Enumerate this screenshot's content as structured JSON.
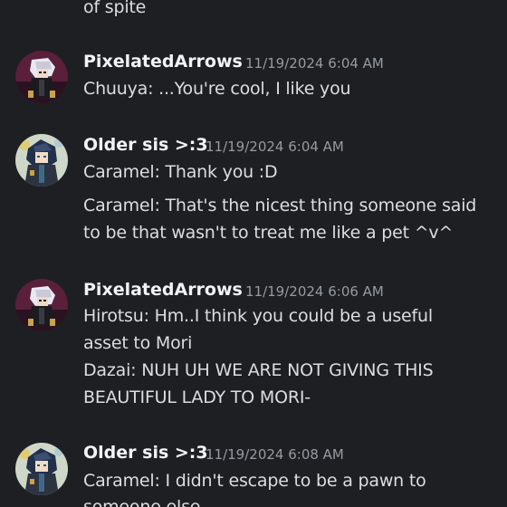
{
  "messages": [
    {
      "lines": [
        "of spite"
      ]
    },
    {
      "author": "PixelatedArrows",
      "timestamp": "11/19/2024 6:04 AM",
      "lines": [
        "Chuuya: ...You're cool, I like you"
      ]
    },
    {
      "author": "Older sis >:3",
      "timestamp": "11/19/2024 6:04 AM",
      "lines": [
        "Caramel: Thank you :D",
        "Caramel: That's the nicest thing someone said",
        "to be that wasn't to treat me like a pet ^v^"
      ]
    },
    {
      "author": "PixelatedArrows",
      "timestamp": "11/19/2024 6:06 AM",
      "lines": [
        "Hirotsu: Hm..I think you could be a useful",
        "asset to Mori",
        "Dazai: NUH UH WE ARE NOT GIVING THIS",
        "BEAUTIFUL LADY TO MORI-"
      ]
    },
    {
      "author": "Older sis >:3",
      "timestamp": "11/19/2024 6:08 AM",
      "lines": [
        "Caramel: I didn't escape to be a pawn to",
        "someone else"
      ]
    }
  ],
  "colors": {
    "background": "#1e1f22",
    "text": "#dbdee1",
    "author": "#f2f3f5",
    "timestamp": "#949ba4",
    "avatar_pixelated_bg": "#5a1f3a",
    "avatar_oldersis_bg": "#cfd8c8"
  },
  "icons": {
    "avatar_pixelated": "pixel-character-avatar-icon",
    "avatar_oldersis": "dark-haired-character-avatar-icon"
  }
}
